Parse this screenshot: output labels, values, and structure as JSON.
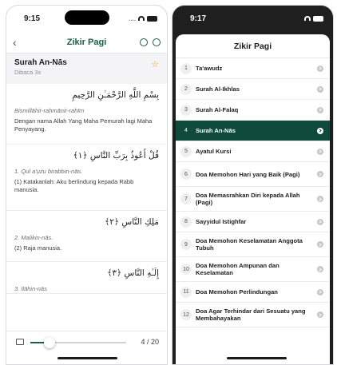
{
  "left": {
    "status_time": "9:15",
    "status_signal": "....",
    "nav": {
      "back": "‹",
      "title": "Zikir Pagi"
    },
    "header": {
      "title": "Surah An-Nās",
      "subtitle": "Dibaca 3x",
      "star": "☆"
    },
    "blocks": [
      {
        "arabic": "بِسْمِ اللَّهِ الرَّحْمَـٰنِ الرَّحِيمِ",
        "latin": "Bismillāhir-raḥmānir-raḥīm",
        "translation": "Dengan nama Allah Yang Maha Pemurah lagi Maha Penyayang."
      },
      {
        "arabic": "قُلْ أَعُوذُ بِرَبِّ النَّاسِ ﴿١﴾",
        "latin": "1. Qul a'ụżu birabbin-nās.",
        "translation": "(1) Katakanlah: Aku berlindung kepada Rabb manusia."
      },
      {
        "arabic": "مَلِكِ النَّاسِ ﴿٢﴾",
        "latin": "2. Malikin-nās.",
        "translation": "(2) Raja manusia."
      },
      {
        "arabic": "إِلَـٰهِ النَّاسِ ﴿٣﴾",
        "latin": "3. Ilāhin-nās",
        "translation": ""
      }
    ],
    "progress": {
      "label": "4 / 20",
      "fraction": 0.2
    }
  },
  "right": {
    "status_time": "9:17",
    "sheet_title": "Zikir Pagi",
    "selected_index": 4,
    "items": [
      {
        "num": "1",
        "label": "Ta'awudz"
      },
      {
        "num": "2",
        "label": "Surah Al-Ikhlas"
      },
      {
        "num": "3",
        "label": "Surah Al-Falaq"
      },
      {
        "num": "4",
        "label": "Surah An-Nās"
      },
      {
        "num": "5",
        "label": "Ayatul Kursi"
      },
      {
        "num": "6",
        "label": "Doa Memohon Hari yang Baik (Pagi)"
      },
      {
        "num": "7",
        "label": "Doa Memasrahkan Diri kepada Allah (Pagi)"
      },
      {
        "num": "8",
        "label": "Sayyidul Istighfar"
      },
      {
        "num": "9",
        "label": "Doa Memohon Keselamatan Anggota Tubuh"
      },
      {
        "num": "10",
        "label": "Doa Memohon Ampunan dan Keselamatan"
      },
      {
        "num": "11",
        "label": "Doa Memohon Perlindungan"
      },
      {
        "num": "12",
        "label": "Doa Agar Terhindar dari Sesuatu yang Membahayakan"
      }
    ]
  },
  "colors": {
    "accent": "#1b5e4a",
    "selected_row": "#0f4a3c",
    "star": "#f0a020"
  }
}
